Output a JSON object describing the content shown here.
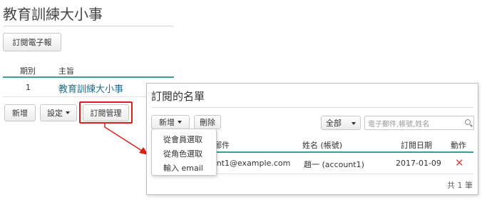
{
  "page": {
    "title": "教育訓練大小事",
    "subscribe_button": "訂閱電子報"
  },
  "newsletter_table": {
    "headers": [
      "期別",
      "主旨"
    ],
    "rows": [
      {
        "issue": "1",
        "subject": "教育訓練大小事"
      }
    ]
  },
  "toolbar": {
    "add_label": "新增",
    "settings_label": "設定",
    "manage_label": "訂閱管理"
  },
  "subscriber_panel": {
    "title": "訂閱的名單",
    "add_label": "新增",
    "delete_label": "刪除",
    "filter_value": "全部",
    "search_placeholder": "電子郵件,帳號,姓名",
    "columns": {
      "email": "郵件",
      "name": "姓名 (帳號)",
      "date": "訂閱日期",
      "action": "動作"
    },
    "rows": [
      {
        "email": "ount1@example.com",
        "name": "趙一 (account1)",
        "date": "2017-01-09"
      }
    ],
    "footer": "共 1 筆",
    "add_menu": [
      "從會員選取",
      "從角色選取",
      "輸入 email"
    ]
  },
  "colors": {
    "accent_teal": "#3a9f9a",
    "highlight_red": "#d9201b",
    "link_blue": "#1f6f8b",
    "delete_red": "#e04848"
  },
  "icons": {
    "arrow": "red-arrow-icon",
    "search": "search-icon",
    "delete": "close-icon",
    "caret": "chevron-down-icon"
  }
}
